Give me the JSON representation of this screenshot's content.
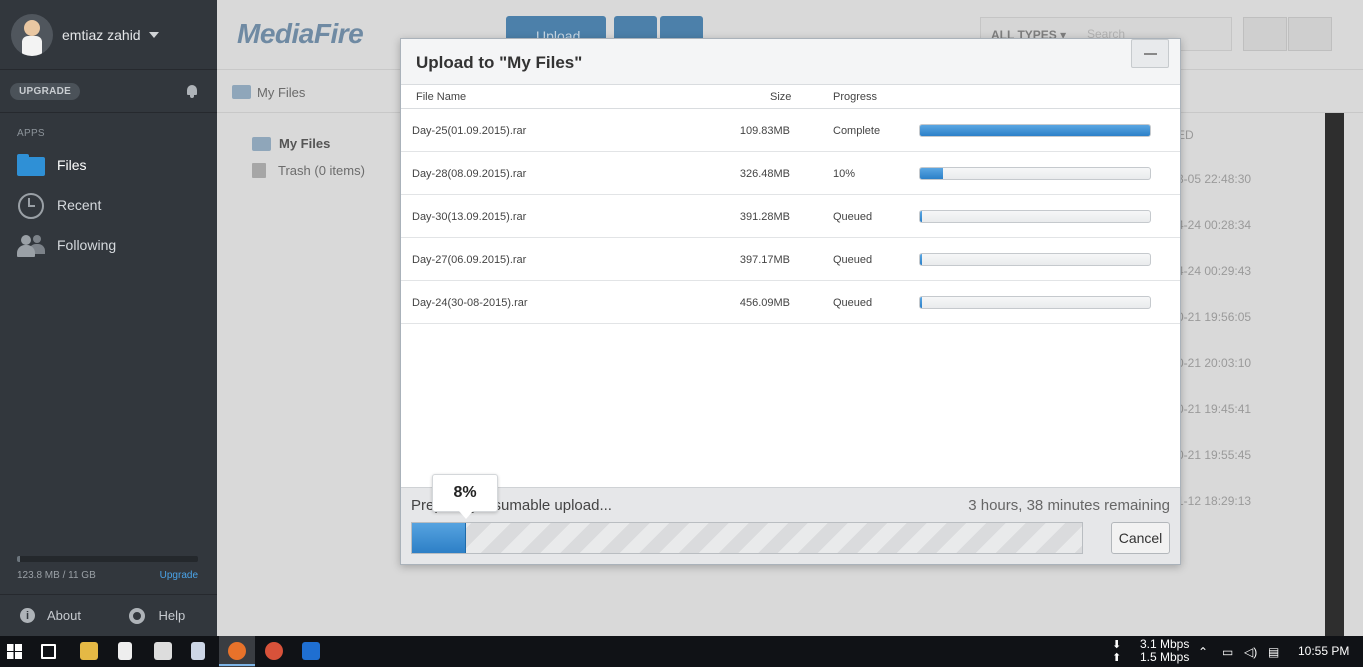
{
  "user": {
    "name": "emtiaz zahid"
  },
  "sidebar": {
    "upgrade_pill": "UPGRADE",
    "apps_label": "APPS",
    "items": [
      {
        "label": "Files",
        "icon": "folder-icon"
      },
      {
        "label": "Recent",
        "icon": "clock-icon"
      },
      {
        "label": "Following",
        "icon": "people-icon"
      }
    ],
    "storage": {
      "used": "123.8 MB / 11 GB",
      "upgrade_link": "Upgrade",
      "used_fraction": 0.011
    },
    "footer": {
      "about": "About",
      "help": "Help"
    }
  },
  "header": {
    "logo": "MediaFire",
    "upload_label": "Upload",
    "type_filter": "ALL TYPES",
    "search_placeholder": "Search"
  },
  "breadcrumb": {
    "root": "My Files"
  },
  "tree": {
    "my_files": "My Files",
    "trash": "Trash (0 items)"
  },
  "background_list": {
    "column_header": "ED",
    "modified": [
      "3-05 22:48:30",
      "4-24 00:28:34",
      "4-24 00:29:43",
      "0-21 19:56:05",
      "0-21 20:03:10",
      "0-21 19:45:41",
      "0-21 19:55:45",
      "1-12 18:29:13"
    ]
  },
  "modal": {
    "title": "Upload to \"My Files\"",
    "columns": {
      "name": "File Name",
      "size": "Size",
      "progress": "Progress"
    },
    "files": [
      {
        "name": "Day-25(01.09.2015).rar",
        "size": "109.83MB",
        "status": "Complete",
        "progress": 1.0
      },
      {
        "name": "Day-28(08.09.2015).rar",
        "size": "326.48MB",
        "status": "10%",
        "progress": 0.1
      },
      {
        "name": "Day-30(13.09.2015).rar",
        "size": "391.28MB",
        "status": "Queued",
        "progress": 0.0
      },
      {
        "name": "Day-27(06.09.2015).rar",
        "size": "397.17MB",
        "status": "Queued",
        "progress": 0.0
      },
      {
        "name": "Day-24(30-08-2015).rar",
        "size": "456.09MB",
        "status": "Queued",
        "progress": 0.0
      }
    ],
    "overall": {
      "status_text": "Preparing resumable upload...",
      "remaining": "3 hours, 38 minutes remaining",
      "percent_label": "8%",
      "progress": 0.08
    },
    "cancel_label": "Cancel"
  },
  "taskbar": {
    "download_speed": "3.1 Mbps",
    "upload_speed": "1.5 Mbps",
    "time": "10:55 PM"
  }
}
